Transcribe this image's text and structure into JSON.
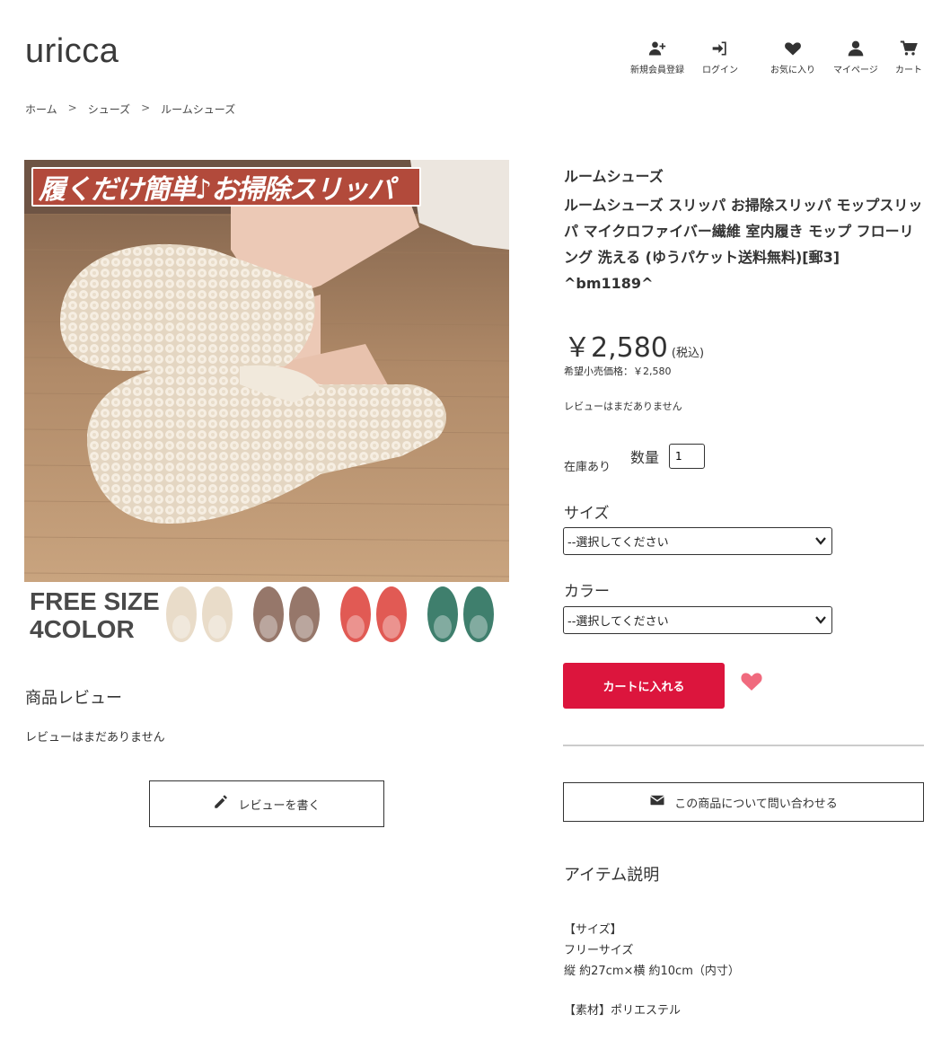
{
  "header": {
    "logo": "uricca",
    "nav": [
      {
        "label": "新規会員登録",
        "icon": "user-plus-icon"
      },
      {
        "label": "ログイン",
        "icon": "sign-in-icon"
      },
      {
        "label": "お気に入り",
        "icon": "heart-icon"
      },
      {
        "label": "マイページ",
        "icon": "user-icon"
      },
      {
        "label": "カート",
        "icon": "cart-icon"
      }
    ]
  },
  "breadcrumb": {
    "items": [
      "ホーム",
      "シューズ",
      "ルームシューズ"
    ],
    "separator": ">"
  },
  "image": {
    "banner_text": "履くだけ簡単♪お掃除スリッパ",
    "size_text_1": "FREE SIZE",
    "size_text_2": "4COLOR",
    "colors": [
      "#e9dcc9",
      "#96776a",
      "#e15a54",
      "#3f7f6d"
    ]
  },
  "product": {
    "category": "ルームシューズ",
    "title": "ルームシューズ スリッパ お掃除スリッパ モップスリッパ マイクロファイバー繊維 室内履き モップ フローリング 洗える (ゆうパケット送料無料)[郵3] ^bm1189^",
    "price": "￥2,580",
    "tax_label": "(税込)",
    "msrp": "希望小売価格：￥2,580",
    "review_status": "レビューはまだありません",
    "stock": "在庫あり",
    "qty_label": "数量",
    "qty_value": "1",
    "size_label": "サイズ",
    "size_select": "--選択してください",
    "color_label": "カラー",
    "color_select": "--選択してください",
    "cart_button": "カートに入れる",
    "accent_color": "#dc153d",
    "heart_color": "#f06a7e",
    "inquiry_button": "この商品について問い合わせる"
  },
  "reviews": {
    "title": "商品レビュー",
    "empty": "レビューはまだありません",
    "write_button": "レビューを書く"
  },
  "description": {
    "title": "アイテム説明",
    "size_heading": "【サイズ】",
    "size_value": "フリーサイズ",
    "dimensions": "縦 約27cm×横 約10cm（内寸）",
    "material": "【素材】ポリエステル"
  }
}
